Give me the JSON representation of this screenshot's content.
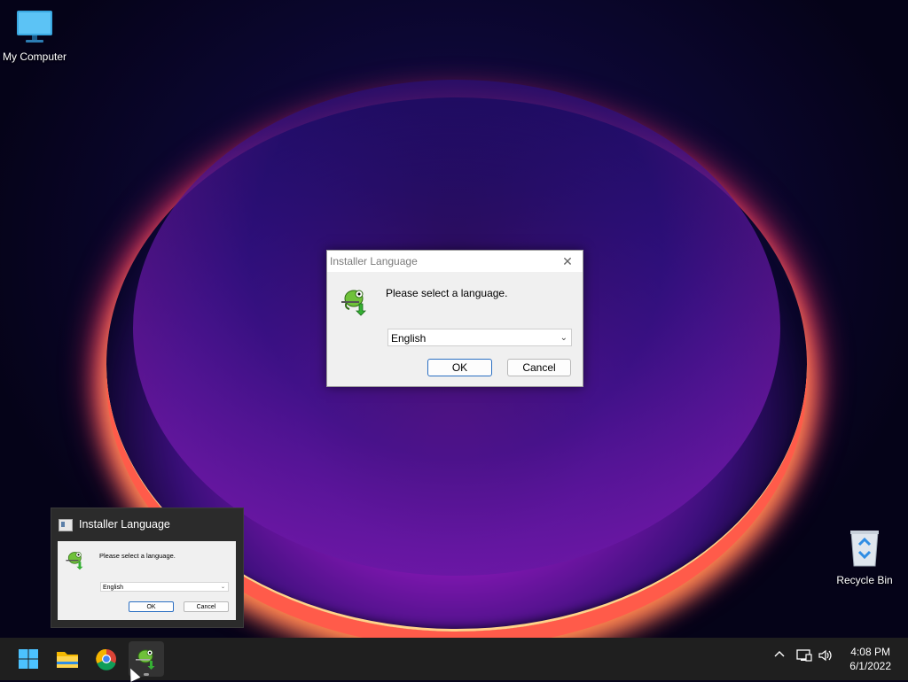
{
  "desktop": {
    "icons": [
      {
        "label": "My Computer",
        "icon": "monitor-icon"
      },
      {
        "label": "Recycle Bin",
        "icon": "recycle-bin-icon"
      }
    ]
  },
  "dialog": {
    "title": "Installer Language",
    "message": "Please select a language.",
    "select_value": "English",
    "ok_label": "OK",
    "cancel_label": "Cancel",
    "close_glyph": "✕"
  },
  "preview": {
    "title": "Installer Language",
    "message": "Please select a language.",
    "select_value": "English",
    "ok_label": "OK",
    "cancel_label": "Cancel"
  },
  "taskbar": {
    "apps": [
      "start-icon",
      "file-explorer-icon",
      "chrome-icon",
      "installer-icon"
    ],
    "tray": [
      "chevron-up-icon",
      "network-icon",
      "volume-icon"
    ],
    "time": "4:08 PM",
    "date": "6/1/2022"
  },
  "colors": {
    "accent": "#2b6fc2",
    "taskbar": "#1f1f1f"
  }
}
